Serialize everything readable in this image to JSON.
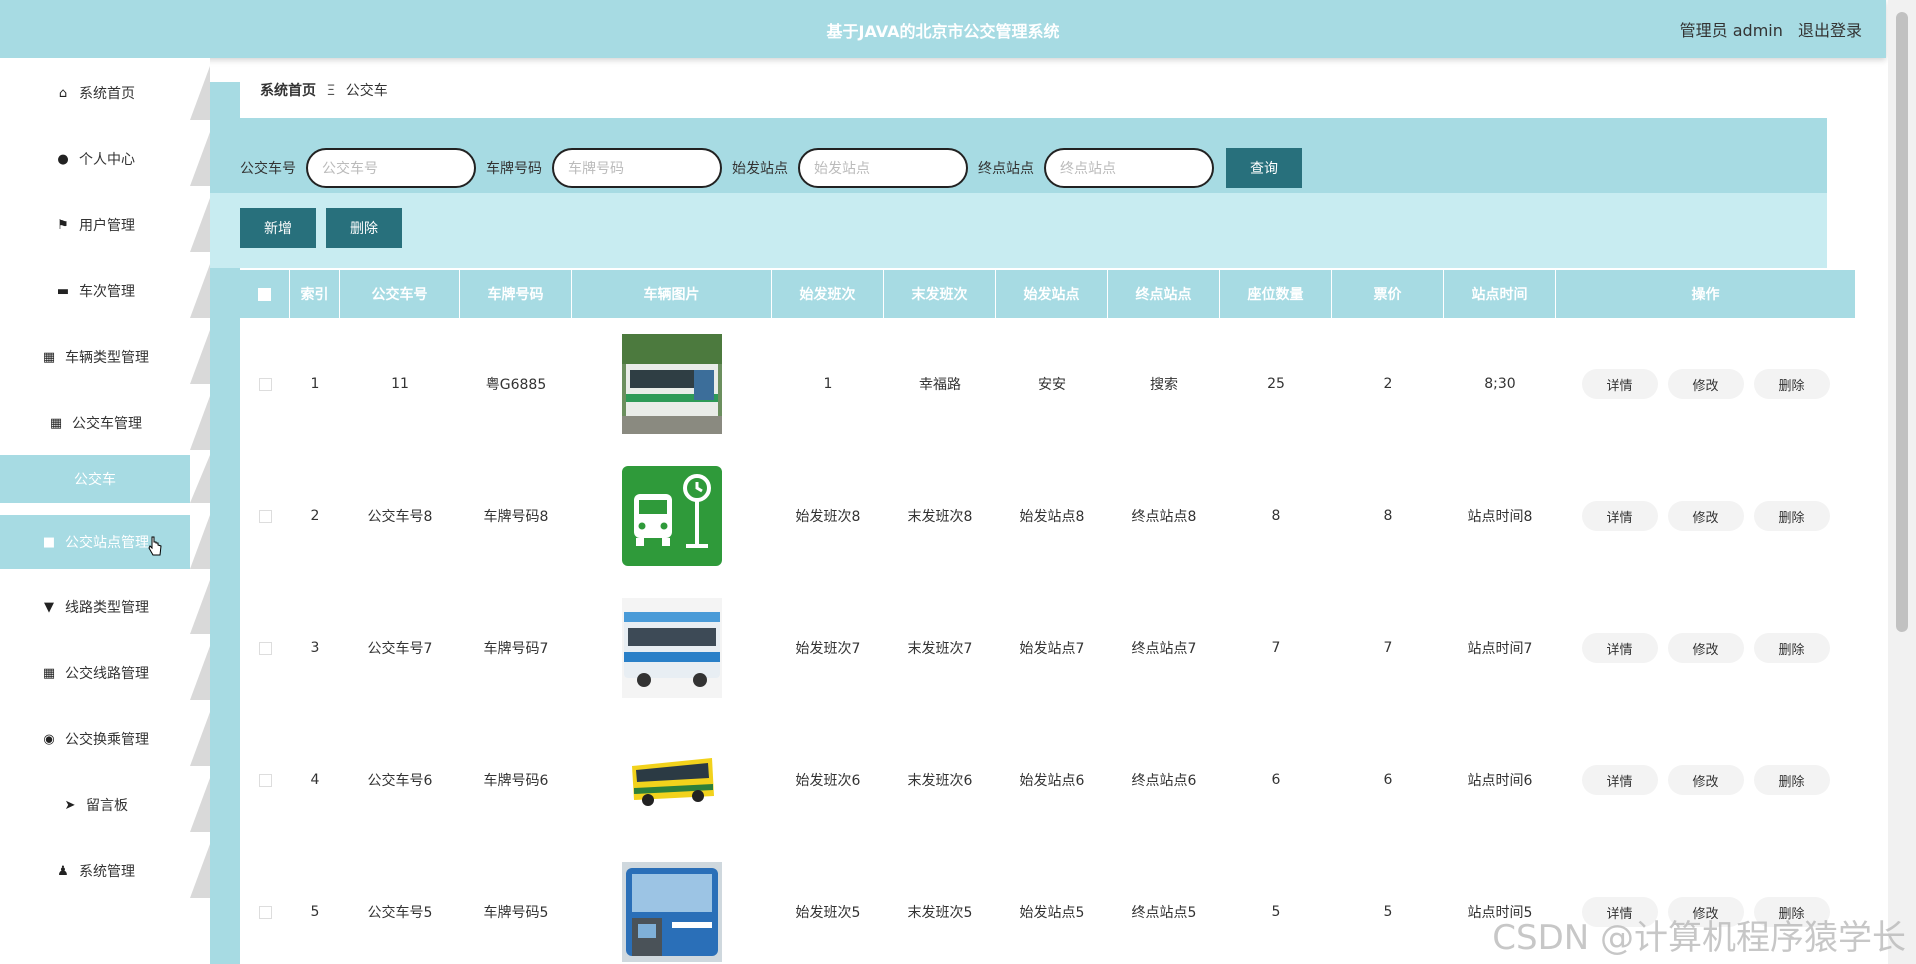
{
  "header": {
    "title": "基于JAVA的北京市公交管理系统",
    "user_label": "管理员 admin",
    "logout": "退出登录"
  },
  "sidebar": {
    "items": [
      {
        "label": "系统首页",
        "icon": "home-icon"
      },
      {
        "label": "个人中心",
        "icon": "user-icon"
      },
      {
        "label": "用户管理",
        "icon": "flag-icon"
      },
      {
        "label": "车次管理",
        "icon": "briefcase-icon"
      },
      {
        "label": "车辆类型管理",
        "icon": "grid-icon"
      },
      {
        "label": "公交车管理",
        "icon": "grid-icon"
      },
      {
        "label": "公交车",
        "icon": ""
      },
      {
        "label": "公交站点管理",
        "icon": "square-icon"
      },
      {
        "label": "线路类型管理",
        "icon": "lamp-icon"
      },
      {
        "label": "公交线路管理",
        "icon": "grid-icon"
      },
      {
        "label": "公交换乘管理",
        "icon": "bulb-icon"
      },
      {
        "label": "留言板",
        "icon": "send-icon"
      },
      {
        "label": "系统管理",
        "icon": "person-icon"
      }
    ]
  },
  "breadcrumb": {
    "home": "系统首页",
    "separator": "Ξ",
    "current": "公交车"
  },
  "search": {
    "fields": [
      {
        "label": "公交车号",
        "placeholder": "公交车号"
      },
      {
        "label": "车牌号码",
        "placeholder": "车牌号码"
      },
      {
        "label": "始发站点",
        "placeholder": "始发站点"
      },
      {
        "label": "终点站点",
        "placeholder": "终点站点"
      }
    ],
    "query_button": "查询"
  },
  "actions": {
    "add": "新增",
    "delete": "删除"
  },
  "table": {
    "headers": [
      "索引",
      "公交车号",
      "车牌号码",
      "车辆图片",
      "始发班次",
      "末发班次",
      "始发站点",
      "终点站点",
      "座位数量",
      "票价",
      "站点时间",
      "操作"
    ],
    "rows": [
      {
        "idx": "1",
        "bus_no": "11",
        "plate": "粤G6885",
        "image": "tram-photo",
        "first": "1",
        "last": "幸福路",
        "start": "安安",
        "end": "搜索",
        "seats": "25",
        "price": "2",
        "time": "8;30"
      },
      {
        "idx": "2",
        "bus_no": "公交车号8",
        "plate": "车牌号码8",
        "image": "bus-stop-icon",
        "first": "始发班次8",
        "last": "末发班次8",
        "start": "始发站点8",
        "end": "终点站点8",
        "seats": "8",
        "price": "8",
        "time": "站点时间8"
      },
      {
        "idx": "3",
        "bus_no": "公交车号7",
        "plate": "车牌号码7",
        "image": "white-bus-photo",
        "first": "始发班次7",
        "last": "末发班次7",
        "start": "始发站点7",
        "end": "终点站点7",
        "seats": "7",
        "price": "7",
        "time": "站点时间7"
      },
      {
        "idx": "4",
        "bus_no": "公交车号6",
        "plate": "车牌号码6",
        "image": "yellow-bus-photo",
        "first": "始发班次6",
        "last": "末发班次6",
        "start": "始发站点6",
        "end": "终点站点6",
        "seats": "6",
        "price": "6",
        "time": "站点时间6"
      },
      {
        "idx": "5",
        "bus_no": "公交车号5",
        "plate": "车牌号码5",
        "image": "blue-bus-photo",
        "first": "始发班次5",
        "last": "末发班次5",
        "start": "始发站点5",
        "end": "终点站点5",
        "seats": "5",
        "price": "5",
        "time": "站点时间5"
      }
    ],
    "op_labels": {
      "detail": "详情",
      "edit": "修改",
      "delete": "删除"
    }
  },
  "watermark": "CSDN @计算机程序猿学长",
  "colors": {
    "accent": "#a7dbe3",
    "button": "#28707c"
  }
}
